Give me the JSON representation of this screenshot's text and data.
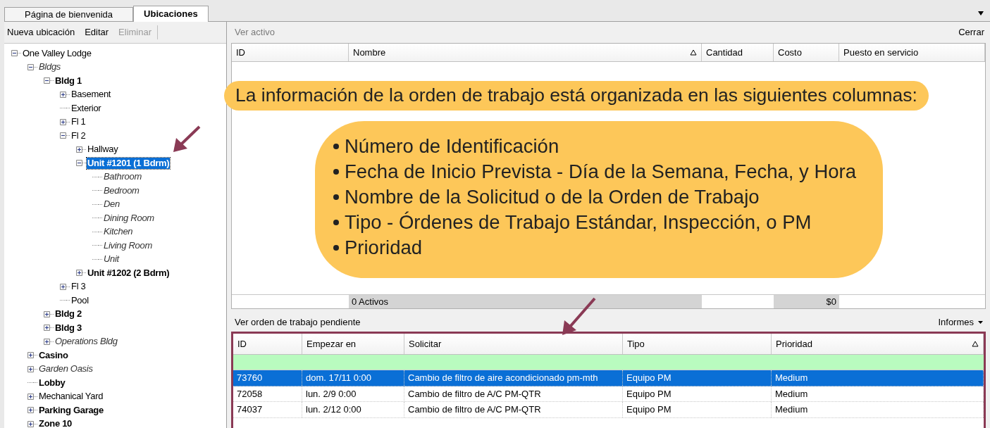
{
  "tabs": [
    {
      "label": "Página de bienvenida",
      "selected": false
    },
    {
      "label": "Ubicaciones",
      "selected": true
    }
  ],
  "toolbar": [
    {
      "label": "Nueva ubicación",
      "disabled": false
    },
    {
      "label": "Editar",
      "disabled": false
    },
    {
      "label": "Eliminar",
      "disabled": true
    }
  ],
  "tree": [
    {
      "label": "One Valley Lodge",
      "kind": "standard",
      "expanded": true,
      "selected": false,
      "children": [
        {
          "label": "Bldgs",
          "kind": "secondary",
          "expanded": true,
          "selected": false,
          "children": [
            {
              "label": "Bldg 1",
              "kind": "primary",
              "expanded": true,
              "selected": false,
              "children": [
                {
                  "label": "Basement",
                  "kind": "standard",
                  "expanded": false,
                  "selected": false
                },
                {
                  "label": "Exterior",
                  "kind": "standard",
                  "selected": false
                },
                {
                  "label": "Fl 1",
                  "kind": "standard",
                  "expanded": false,
                  "selected": false
                },
                {
                  "label": "Fl 2",
                  "kind": "standard",
                  "expanded": true,
                  "selected": false,
                  "children": [
                    {
                      "label": "Hallway",
                      "kind": "standard",
                      "expanded": false,
                      "selected": false
                    },
                    {
                      "label": "Unit #1201 (1 Bdrm)",
                      "kind": "primary",
                      "expanded": true,
                      "selected": true,
                      "children": [
                        {
                          "label": "Bathroom",
                          "kind": "secondary",
                          "selected": false
                        },
                        {
                          "label": "Bedroom",
                          "kind": "secondary",
                          "selected": false
                        },
                        {
                          "label": "Den",
                          "kind": "secondary",
                          "selected": false
                        },
                        {
                          "label": "Dining Room",
                          "kind": "secondary",
                          "selected": false
                        },
                        {
                          "label": "Kitchen",
                          "kind": "secondary",
                          "selected": false
                        },
                        {
                          "label": "Living Room",
                          "kind": "secondary",
                          "selected": false
                        },
                        {
                          "label": "Unit",
                          "kind": "secondary",
                          "selected": false
                        }
                      ]
                    },
                    {
                      "label": "Unit #1202 (2 Bdrm)",
                      "kind": "primary",
                      "expanded": false,
                      "selected": false
                    }
                  ]
                },
                {
                  "label": "Fl 3",
                  "kind": "standard",
                  "expanded": false,
                  "selected": false
                },
                {
                  "label": "Pool",
                  "kind": "standard",
                  "selected": false
                }
              ]
            },
            {
              "label": "Bldg 2",
              "kind": "primary",
              "expanded": false,
              "selected": false
            },
            {
              "label": "Bldg 3",
              "kind": "primary",
              "expanded": false,
              "selected": false
            },
            {
              "label": "Operations Bldg",
              "kind": "secondary",
              "expanded": false,
              "selected": false
            }
          ]
        },
        {
          "label": "Casino",
          "kind": "primary",
          "expanded": false,
          "selected": false
        },
        {
          "label": "Garden Oasis",
          "kind": "secondary",
          "expanded": false,
          "selected": false
        },
        {
          "label": "Lobby",
          "kind": "primary",
          "selected": false
        },
        {
          "label": "Mechanical Yard",
          "kind": "standard",
          "expanded": false,
          "selected": false
        },
        {
          "label": "Parking Garage",
          "kind": "primary",
          "expanded": false,
          "selected": false
        },
        {
          "label": "Zone 10",
          "kind": "primary",
          "expanded": false,
          "selected": false
        }
      ]
    }
  ],
  "assets_panel": {
    "title": "Ver activo",
    "close": "Cerrar",
    "columns": [
      {
        "label": "ID",
        "sorted": false
      },
      {
        "label": "Nombre",
        "sorted": true
      },
      {
        "label": "Cantidad",
        "sorted": false
      },
      {
        "label": "Costo",
        "sorted": false
      },
      {
        "label": "Puesto en servicio",
        "sorted": false
      }
    ],
    "footer": {
      "count": "0 Activos",
      "total": "$0"
    }
  },
  "work_orders_panel": {
    "title": "Ver orden de trabajo pendiente",
    "reports": "Informes",
    "columns": [
      {
        "label": "ID",
        "sorted": false
      },
      {
        "label": "Empezar en",
        "sorted": false
      },
      {
        "label": "Solicitar",
        "sorted": false
      },
      {
        "label": "Tipo",
        "sorted": false
      },
      {
        "label": "Prioridad",
        "sorted": true
      }
    ],
    "rows": [
      {
        "cells": [
          "73760",
          "dom. 17/11 0:00",
          "Cambio de filtro de aire acondicionado pm-mth",
          "Equipo PM",
          "Medium"
        ],
        "selected": true
      },
      {
        "cells": [
          "72058",
          "lun. 2/9 0:00",
          "Cambio de filtro de A/C PM-QTR",
          "Equipo PM",
          "Medium"
        ],
        "selected": false
      },
      {
        "cells": [
          "74037",
          "lun. 2/12 0:00",
          "Cambio de filtro de A/C PM-QTR",
          "Equipo PM",
          "Medium"
        ],
        "selected": false
      }
    ]
  },
  "callout": {
    "heading": "La información de la orden de trabajo está organizada en las siguientes columnas:",
    "items": [
      "Número de Identificación",
      "Fecha de Inicio Prevista - Día de la Semana, Fecha, y Hora",
      "Nombre de la Solicitud o de la Orden de Trabajo",
      "Tipo - Órdenes de Trabajo Estándar, Inspección, o PM",
      "Prioridad"
    ]
  }
}
